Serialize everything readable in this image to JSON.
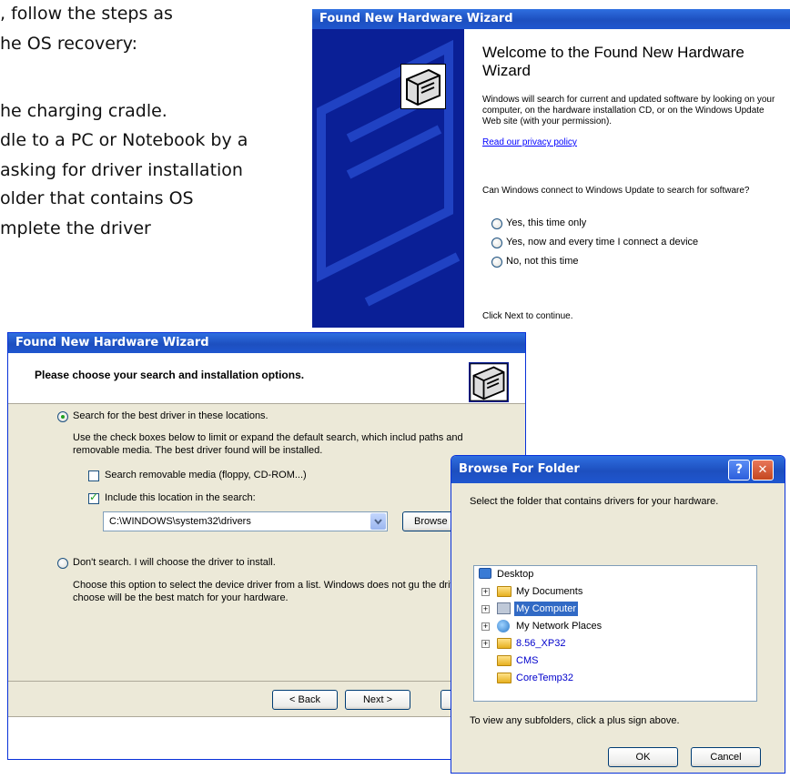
{
  "background_text": {
    "line1": ", follow the steps as",
    "line2": "he OS recovery:",
    "line3": "he charging cradle.",
    "line4": "dle to a PC or Notebook by a",
    "line5": "asking for driver installation",
    "line6": "older that contains OS",
    "line7": "mplete the driver"
  },
  "wizard_welcome": {
    "title": "Found New Hardware Wizard",
    "heading": "Welcome to the Found New Hardware Wizard",
    "intro": "Windows will search for current and updated software by looking on your computer, on the hardware installation CD, or on the Windows Update Web site (with your permission).",
    "privacy_link": "Read our privacy policy",
    "question": "Can Windows connect to Windows Update to search for software?",
    "options": [
      "Yes, this time only",
      "Yes, now and every time I connect a device",
      "No, not this time"
    ],
    "continue_text": "Click Next to continue."
  },
  "wizard_search": {
    "title": "Found New Hardware Wizard",
    "heading": "Please choose your search and installation options.",
    "option_search": "Search for the best driver in these locations.",
    "search_desc": "Use the check boxes below to limit or expand the default search, which includ paths and removable media. The best driver found will be installed.",
    "check_removable": "Search removable media (floppy, CD-ROM...)",
    "check_location": "Include this location in the search:",
    "path_value": "C:\\WINDOWS\\system32\\drivers",
    "browse_label": "Browse",
    "option_dont": "Don't search. I will choose the driver to install.",
    "dont_desc": "Choose this option to select the device driver from a list.  Windows does not gu the driver you choose will be the best match for your hardware.",
    "back_label": "< Back",
    "next_label": "Next >"
  },
  "browse_dialog": {
    "title": "Browse For Folder",
    "prompt": "Select the folder that contains drivers for your hardware.",
    "tree": {
      "root": "Desktop",
      "items": [
        "My Documents",
        "My Computer",
        "My Network Places",
        "8.56_XP32",
        "CMS",
        "CoreTemp32"
      ]
    },
    "hint": "To view any subfolders, click a plus sign above.",
    "ok_label": "OK",
    "cancel_label": "Cancel",
    "help_label": "?",
    "close_label": "✕"
  },
  "colors": {
    "xp_title_blue": "#1d4fbf",
    "wizard_side_blue": "#0a1f96",
    "link_blue": "#0000ff",
    "selection_blue": "#316ac5"
  }
}
